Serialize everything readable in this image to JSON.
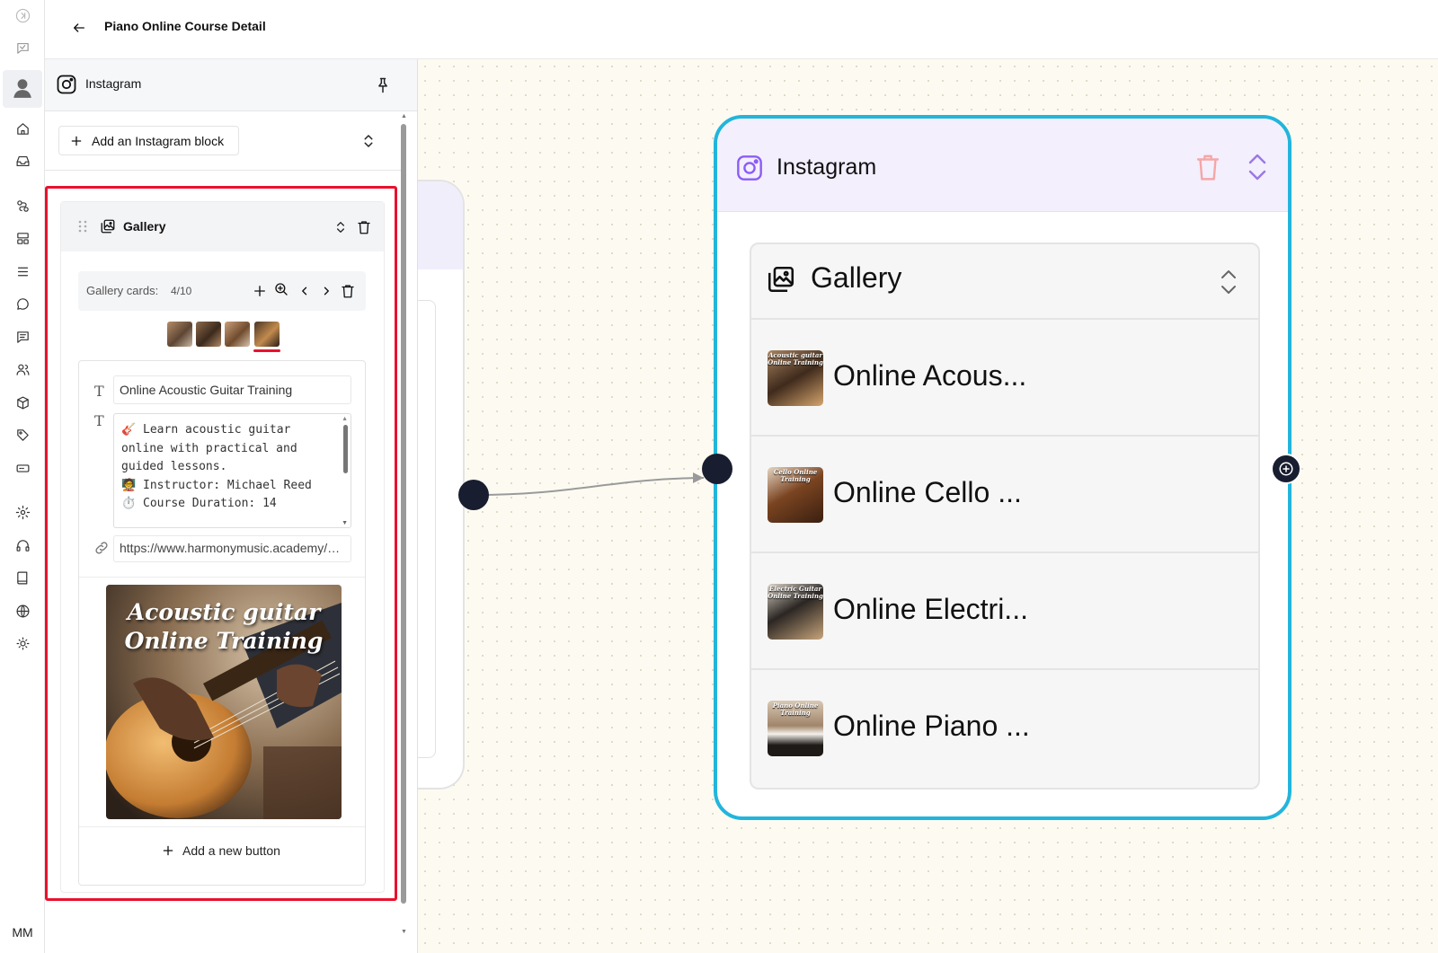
{
  "header": {
    "title": "Piano Online Course Detail"
  },
  "rail": {
    "user_initials": "MM",
    "icons": [
      "expand-icon",
      "chat-bubble-icon",
      "avatar-icon",
      "home-icon",
      "inbox-icon",
      "flow-icon",
      "layout-icon",
      "menu-icon",
      "comment-icon",
      "message-icon",
      "users-icon",
      "box-icon",
      "tag-icon",
      "card-icon",
      "settings-icon",
      "headset-icon",
      "book-icon",
      "globe-icon",
      "sun-icon"
    ]
  },
  "panel": {
    "title": "Instagram",
    "add_block_label": "Add an Instagram block",
    "gallery": {
      "title": "Gallery",
      "cards_label": "Gallery cards:",
      "cards_count": "4/10",
      "selected_thumbnail": 4,
      "card": {
        "title": "Online Acoustic Guitar Training",
        "description": "🎸 Learn acoustic guitar online with practical and guided lessons.\n🧑‍🏫 Instructor: Michael Reed\n⏱️ Course Duration: 14",
        "url": "https://www.harmonymusic.academy/acoustic-guitar",
        "image_caption_line1": "Acoustic guitar",
        "image_caption_line2": "Online Training"
      },
      "add_button_label": "Add a new button"
    }
  },
  "canvas": {
    "node": {
      "title": "Instagram",
      "gallery_title": "Gallery",
      "items": [
        {
          "label": "Online Acous...",
          "thumb_caption": "Acoustic guitar Online Training"
        },
        {
          "label": "Online Cello ...",
          "thumb_caption": "Cello Online Training"
        },
        {
          "label": "Online Electri...",
          "thumb_caption": "Electric Guitar Online Training"
        },
        {
          "label": "Online Piano ...",
          "thumb_caption": "Piano Online Training"
        }
      ]
    }
  },
  "colors": {
    "highlight": "#e8112d",
    "node_border": "#22b5dc",
    "node_header": "#f3effd",
    "trash_accent": "#f4a7a7",
    "chevron_accent": "#9a78e6",
    "instagram_accent": "#8b5cf6",
    "handle": "#181d2f",
    "canvas_bg": "#fdfbf1"
  }
}
